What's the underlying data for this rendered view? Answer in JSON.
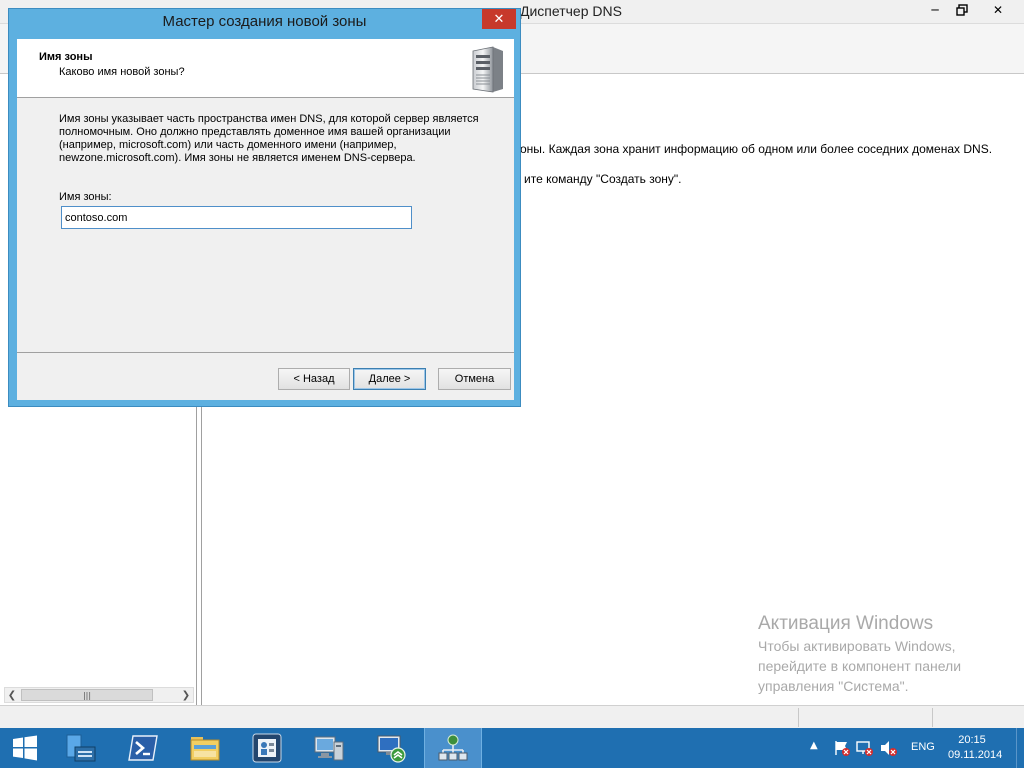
{
  "background_window": {
    "title": "Диспетчер DNS",
    "content_lines": [
      "оны. Каждая зона хранит информацию об одном или более соседних доменах DNS.",
      "ите команду \"Создать зону\"."
    ]
  },
  "dialog": {
    "title": "Мастер создания новой зоны",
    "header_title": "Имя зоны",
    "header_subtitle": "Каково имя новой зоны?",
    "description": [
      "Имя зоны указывает часть пространства имен DNS, для которой сервер является",
      "полномочным. Оно должно представлять доменное имя вашей организации",
      "(например, microsoft.com) или часть доменного имени (например,",
      "newzone.microsoft.com). Имя зоны не является именем DNS-сервера."
    ],
    "zone_label": "Имя зоны:",
    "zone_value": "contoso.com",
    "buttons": {
      "back": "< Назад",
      "next": "Далее >",
      "cancel": "Отмена"
    }
  },
  "watermark": {
    "title": "Активация Windows",
    "lines": [
      "Чтобы активировать Windows,",
      "перейдите в компонент панели",
      "управления \"Система\"."
    ]
  },
  "taskbar": {
    "language": "ENG",
    "time": "20:15",
    "date": "09.11.2014",
    "pinned": [
      "server-manager-icon",
      "powershell-icon",
      "file-explorer-icon",
      "active-directory-icon",
      "computer-management-icon",
      "dns-network-icon",
      "dns-manager-icon"
    ]
  },
  "colors": {
    "dialog_frame": "#5db0e0",
    "close_button": "#c7392b",
    "taskbar": "#1f6fb1",
    "watermark_text": "#a9a9a9"
  }
}
